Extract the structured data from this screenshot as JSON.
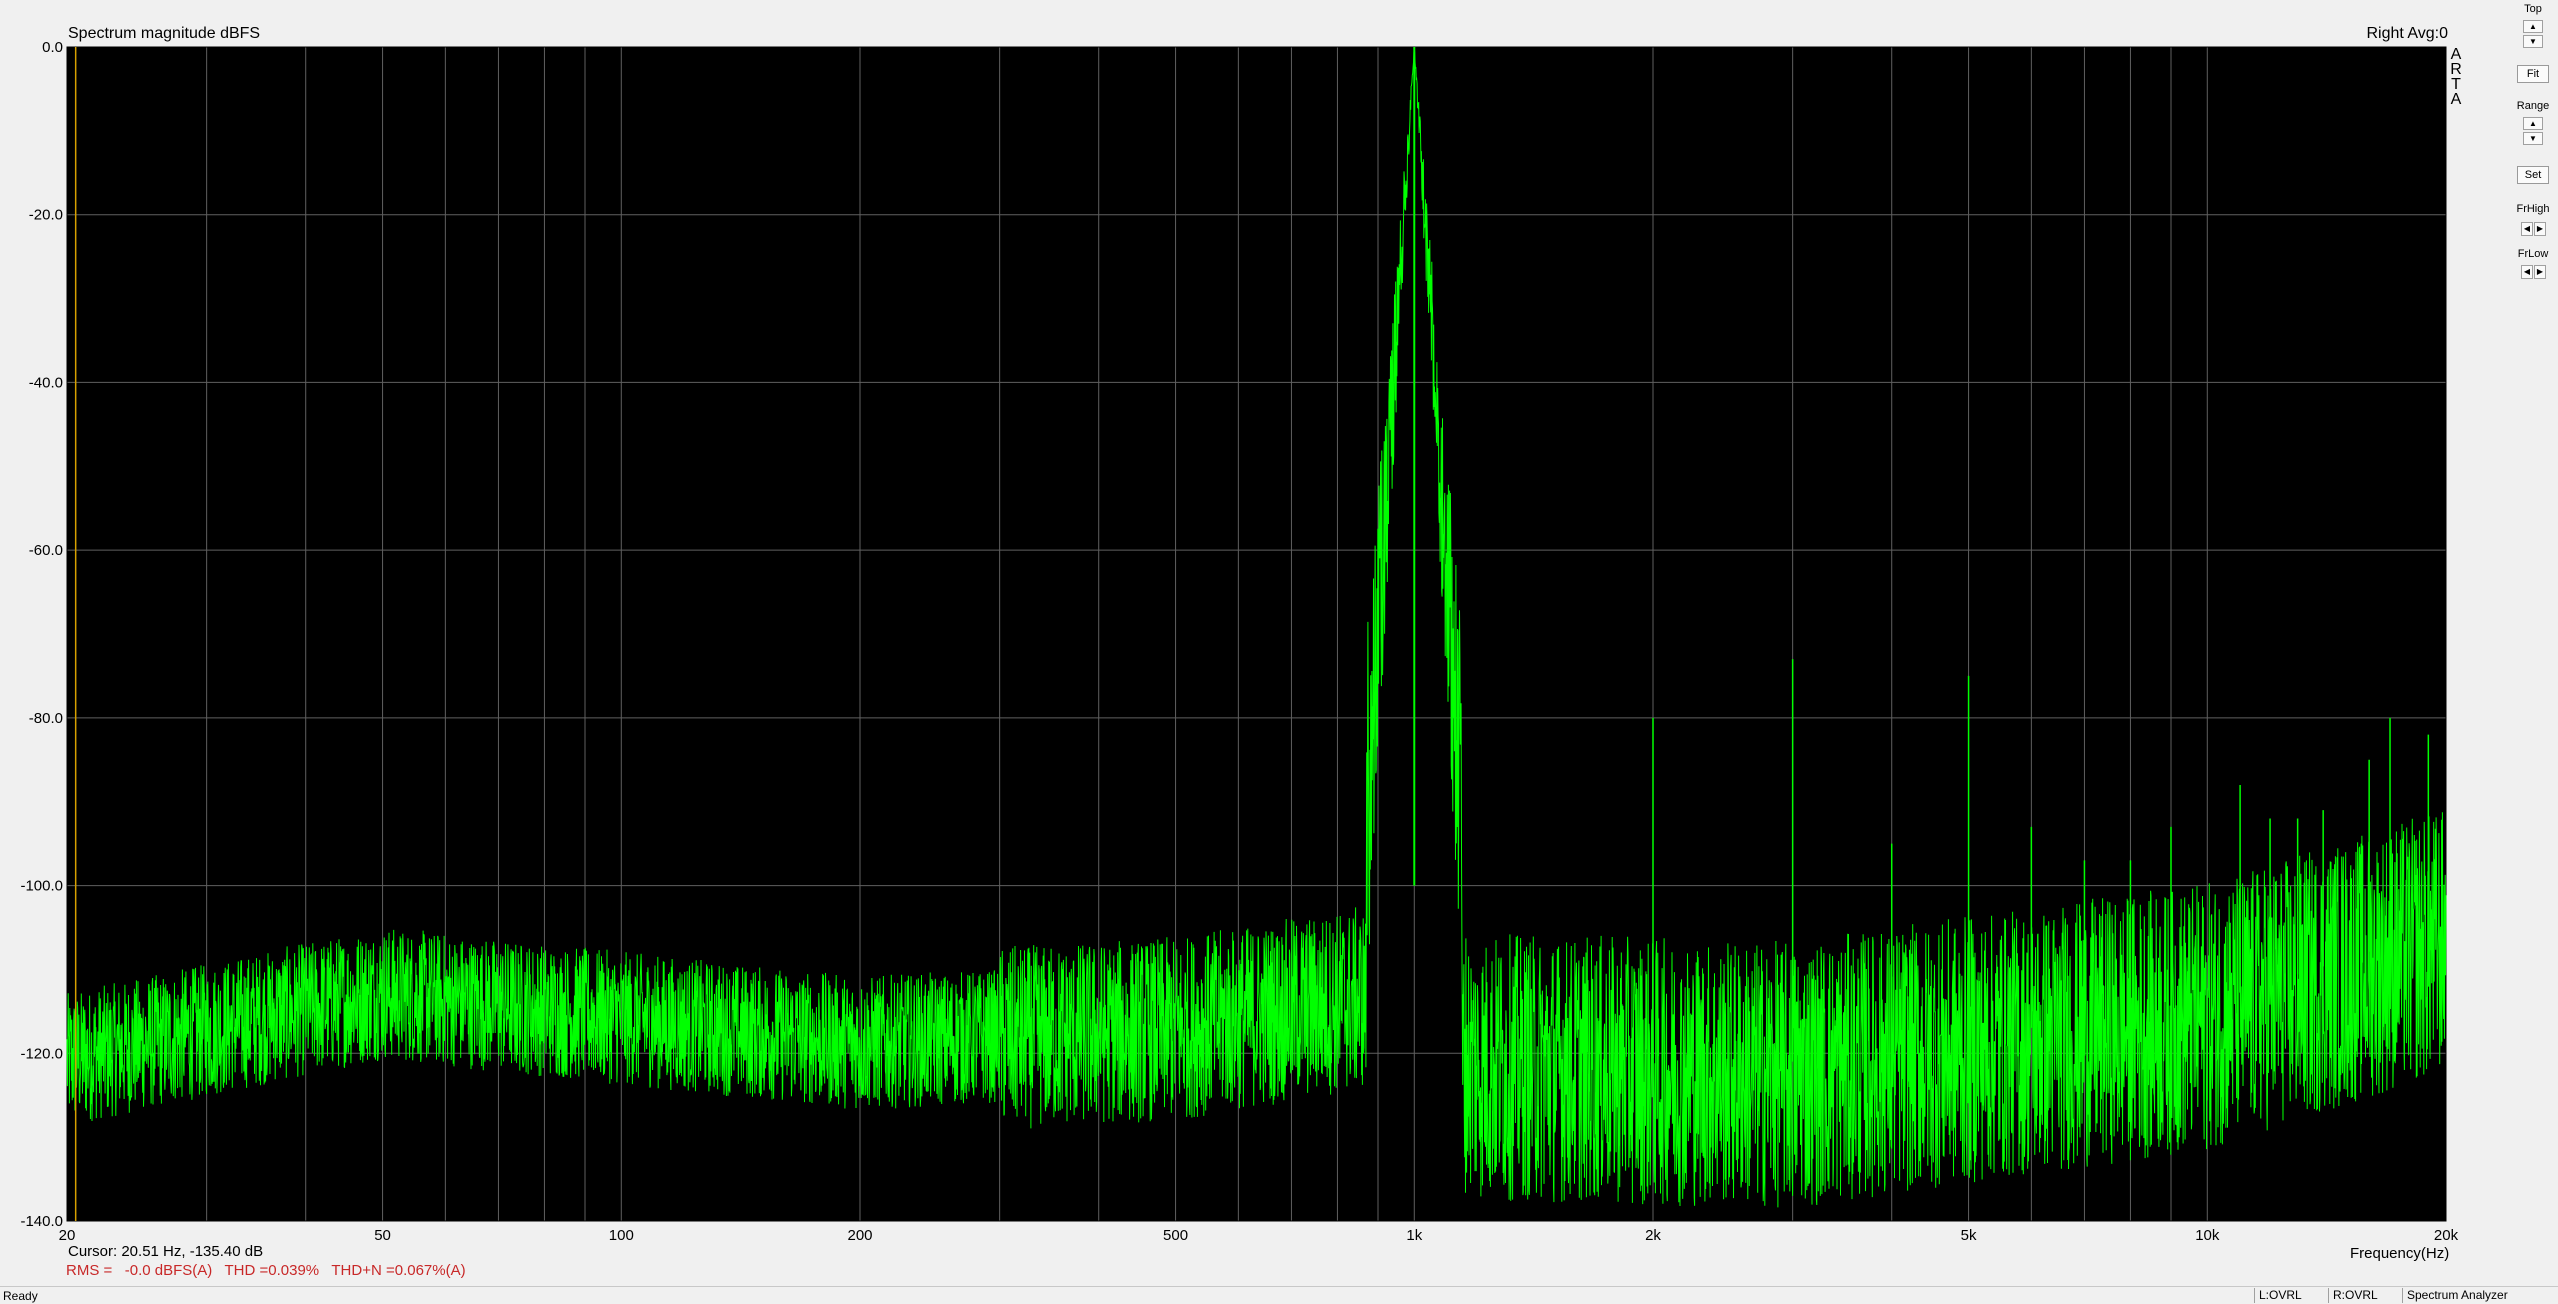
{
  "window": {
    "panel_title": "Spectrum magnitude dBFS",
    "channel_info": "Right  Avg:0",
    "logo": "ARTA"
  },
  "colors": {
    "plot_bg": "#000000",
    "trace": "#00ff00",
    "grid": "#606060",
    "cursor": "#d7a000",
    "measure_text": "#c82828"
  },
  "chart_data": {
    "type": "line",
    "title": "Spectrum magnitude dBFS",
    "xlabel": "Frequency(Hz)",
    "ylabel": "",
    "x_scale": "log",
    "xlim": [
      20,
      20000
    ],
    "ylim": [
      -140,
      0
    ],
    "grid": true,
    "y_ticks": [
      "0.0",
      "-20.0",
      "-40.0",
      "-60.0",
      "-80.0",
      "-100.0",
      "-120.0",
      "-140.0"
    ],
    "x_ticks": [
      {
        "value": 20,
        "label": "20"
      },
      {
        "value": 50,
        "label": "50"
      },
      {
        "value": 100,
        "label": "100"
      },
      {
        "value": 200,
        "label": "200"
      },
      {
        "value": 500,
        "label": "500"
      },
      {
        "value": 1000,
        "label": "1k"
      },
      {
        "value": 2000,
        "label": "2k"
      },
      {
        "value": 5000,
        "label": "5k"
      },
      {
        "value": 10000,
        "label": "10k"
      },
      {
        "value": 20000,
        "label": "20k"
      }
    ],
    "fundamental": {
      "freq": 1000,
      "level": 0.0
    },
    "harmonics": [
      {
        "freq": 2000,
        "level": -80
      },
      {
        "freq": 3000,
        "level": -73
      },
      {
        "freq": 4000,
        "level": -95
      },
      {
        "freq": 5000,
        "level": -75
      },
      {
        "freq": 6000,
        "level": -93
      },
      {
        "freq": 7000,
        "level": -97
      },
      {
        "freq": 8000,
        "level": -97
      },
      {
        "freq": 9000,
        "level": -93
      },
      {
        "freq": 11000,
        "level": -88
      },
      {
        "freq": 12000,
        "level": -92
      },
      {
        "freq": 13000,
        "level": -92
      },
      {
        "freq": 14000,
        "level": -91
      },
      {
        "freq": 16000,
        "level": -85
      },
      {
        "freq": 17000,
        "level": -80
      },
      {
        "freq": 19000,
        "level": -82
      }
    ],
    "noise_floor": [
      {
        "freq": 20,
        "level": -120
      },
      {
        "freq": 50,
        "level": -112
      },
      {
        "freq": 200,
        "level": -118
      },
      {
        "freq": 500,
        "level": -116
      },
      {
        "freq": 900,
        "level": -112
      },
      {
        "freq": 1200,
        "level": -120
      },
      {
        "freq": 3000,
        "level": -121
      },
      {
        "freq": 10000,
        "level": -114
      },
      {
        "freq": 20000,
        "level": -105
      }
    ]
  },
  "cursor": {
    "freq_hz": 20.51,
    "text": "Cursor: 20.51 Hz, -135.40 dB"
  },
  "measurements": {
    "text": "RMS =   -0.0 dBFS(A)   THD =0.039%   THD+N =0.067%(A)"
  },
  "side_panel": {
    "top_label": "Top",
    "fit_label": "Fit",
    "range_label": "Range",
    "set_label": "Set",
    "frhigh_label": "FrHigh",
    "frlow_label": "FrLow"
  },
  "statusbar": {
    "status": "Ready",
    "left_ovrl": "L:OVRL",
    "right_ovrl": "R:OVRL",
    "mode": "Spectrum Analyzer"
  }
}
